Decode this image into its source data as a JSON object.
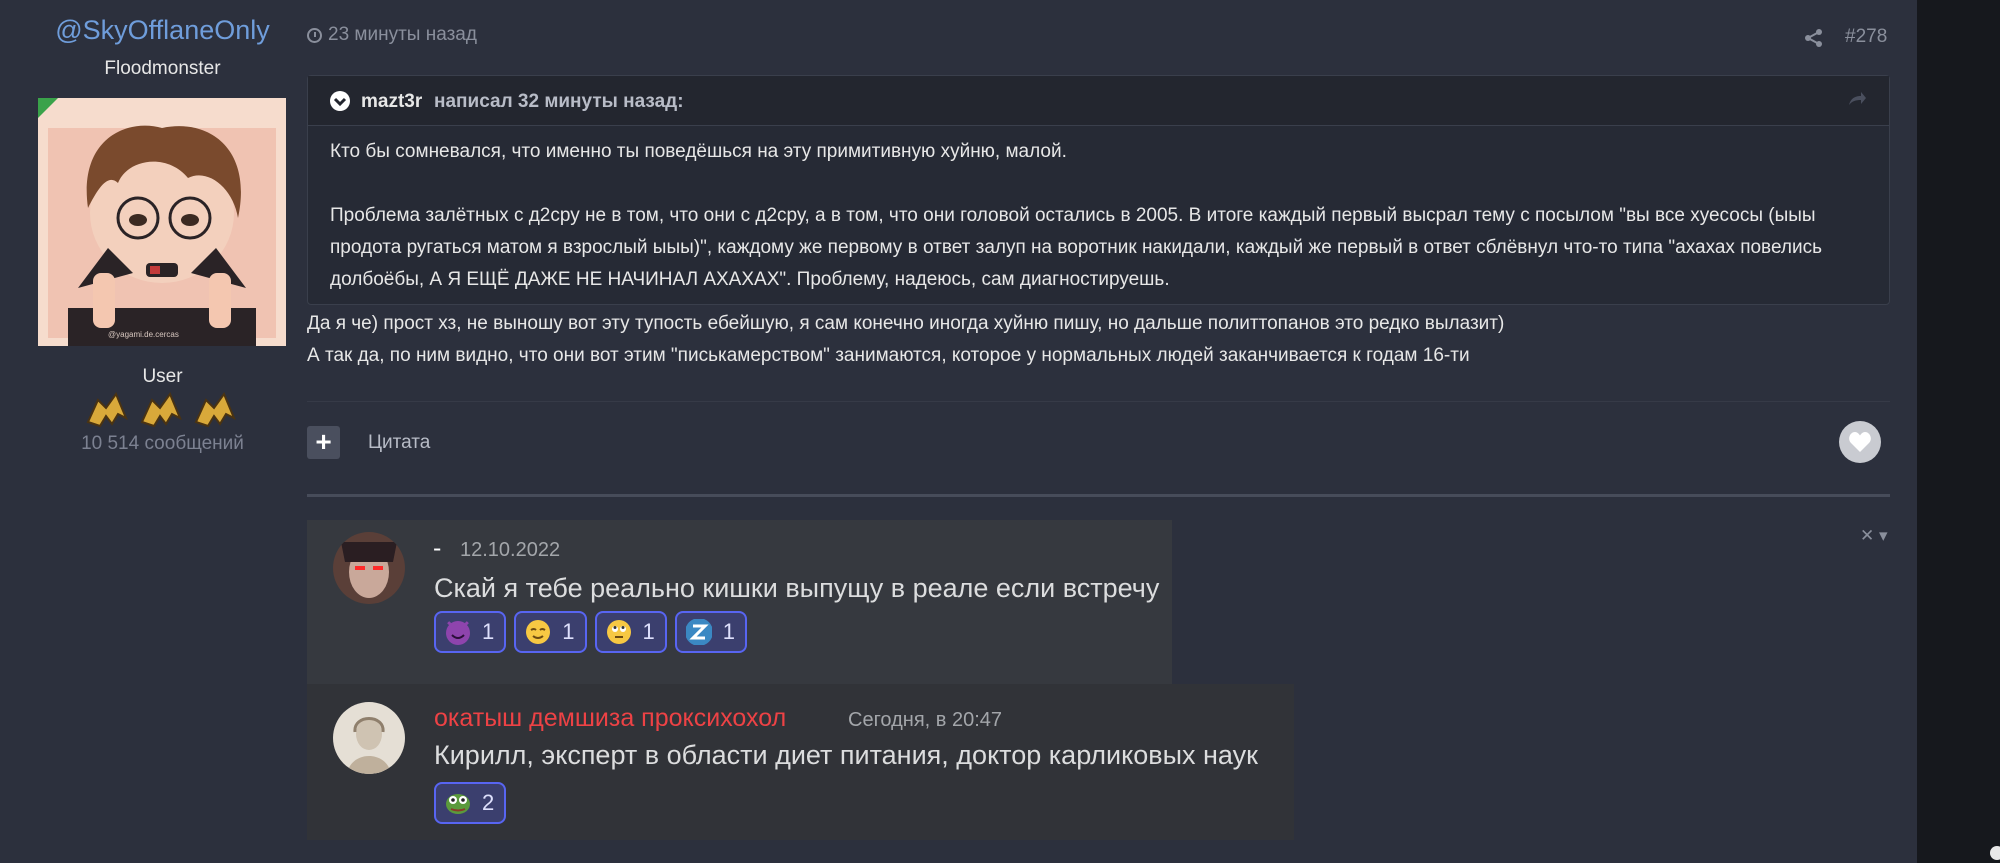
{
  "author": {
    "name": "@SkyOfflaneOnly",
    "title": "Floodmonster",
    "avatar_watermark": "@yagami.de.cercas",
    "role": "User",
    "post_count": "10 514 сообщений"
  },
  "post": {
    "time": "23 минуты назад",
    "number": "#278",
    "quote": {
      "author": "mazt3r",
      "wrote": "написал 32 минуты назад:",
      "lines": [
        "Кто бы сомневался, что именно ты поведёшься на эту примитивную хуйню, малой.",
        "Проблема залётных с д2сру не в том, что они с д2сру, а в том, что они головой остались в 2005. В итоге каждый первый высрал тему с посылом \"вы все хуесосы (ыыы продота ругаться матом я взрослый ыыы)\", каждому же первому в ответ залуп на воротник накидали, каждый же первый в ответ сблёвнул что-то типа \"ахахах повелись долбоёбы, А Я ЕЩЁ ДАЖЕ НЕ НАЧИНАЛ АХАХАХ\". Проблему, надеюсь, сам диагностируешь."
      ]
    },
    "lines": [
      "Да я че) прост хз, не выношу вот эту тупость ебейшую, я сам конечно иногда хуйню пишу, но дальше политтопанов это редко вылазит)",
      "А так да, по ним видно, что они вот этим \"писькамерством\" занимаются, которое у нормальных людей заканчивается к годам 16-ти"
    ],
    "quote_action": "Цитата",
    "plus": "+",
    "close_caret": "✕ ▾"
  },
  "embed": {
    "messages": [
      {
        "author": "-",
        "time": "12.10.2022",
        "text": "Скай я тебе реально кишки выпущу в реале если встречу",
        "reactions": [
          {
            "emoji": "smiling-devil-icon",
            "count": "1"
          },
          {
            "emoji": "relieved-face-icon",
            "count": "1"
          },
          {
            "emoji": "eye-roll-face-icon",
            "count": "1"
          },
          {
            "emoji": "z-letter-icon",
            "count": "1"
          }
        ]
      },
      {
        "author": "окатыш демшиза проксихохол",
        "time": "Сегодня, в 20:47",
        "text": "Кирилл, эксперт в области диет питания, доктор карликовых наук",
        "reactions": [
          {
            "emoji": "pepe-frog-icon",
            "count": "2"
          }
        ]
      }
    ]
  },
  "colors": {
    "username_link": "#6f9ddb",
    "discord_author_red": "#ed4245",
    "reaction_border": "#5865f2"
  }
}
